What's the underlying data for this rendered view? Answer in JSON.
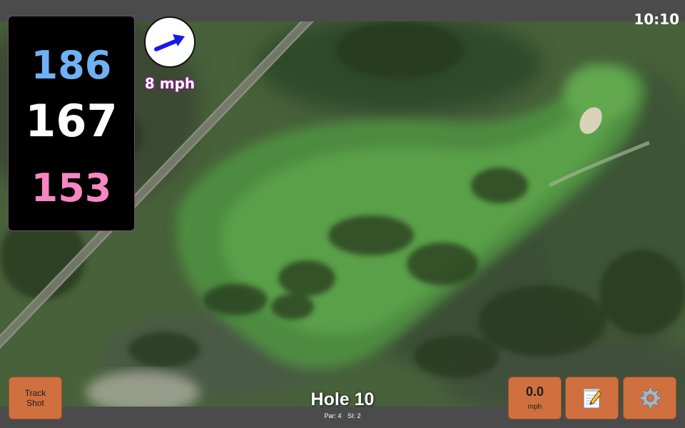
{
  "status_bar": {
    "time": "10:10"
  },
  "distances": {
    "back": "186",
    "middle": "167",
    "front": "153"
  },
  "wind": {
    "label": "8 mph",
    "icon": "wind-direction-arrow-icon",
    "arrow_heading_deg": 70
  },
  "buttons": {
    "track_shot_line1": "Track",
    "track_shot_line2": "Shot",
    "wind_value": "0.0",
    "wind_unit": "mph",
    "notes_icon": "notepad-icon",
    "settings_icon": "gear-icon"
  },
  "hole": {
    "title": "Hole 10",
    "par": "Par: 4",
    "si": "SI: 2"
  },
  "colors": {
    "back_distance": "#6fb1f2",
    "middle_distance": "#ffffff",
    "front_distance": "#f687c3",
    "button": "#d0703f",
    "wind_arrow": "#1a1ae6",
    "wind_text_outline": "#8a1a8a"
  }
}
